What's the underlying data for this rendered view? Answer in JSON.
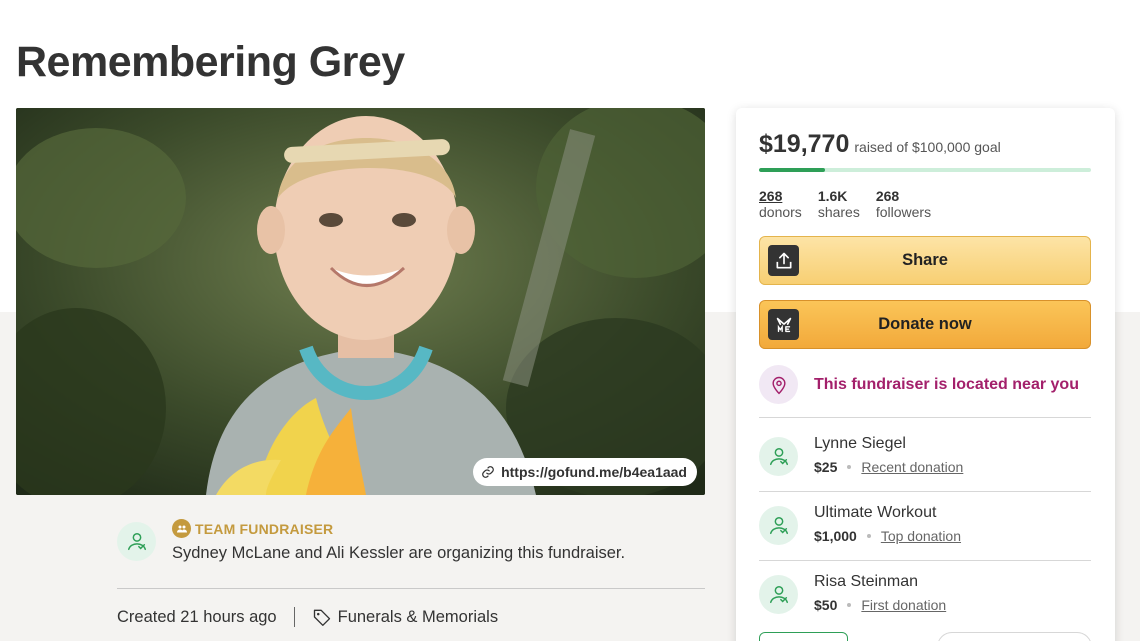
{
  "page": {
    "title": "Remembering Grey"
  },
  "hero": {
    "short_url": "https://gofund.me/b4ea1aad"
  },
  "organizer": {
    "team_label": "TEAM FUNDRAISER",
    "text": "Sydney McLane and Ali Kessler are organizing this fundraiser."
  },
  "meta": {
    "created": "Created 21 hours ago",
    "category": "Funerals & Memorials"
  },
  "progress": {
    "raised": "$19,770",
    "goal_text": "raised of $100,000 goal",
    "fraction": 0.1977,
    "donors_count": "268",
    "donors_label": "donors",
    "shares_count": "1.6K",
    "shares_label": "shares",
    "followers_count": "268",
    "followers_label": "followers"
  },
  "actions": {
    "share_label": "Share",
    "donate_label": "Donate now"
  },
  "location_notice": "This fundraiser is located near you",
  "donations": [
    {
      "name": "Lynne Siegel",
      "amount": "$25",
      "type": "Recent donation"
    },
    {
      "name": "Ultimate Workout",
      "amount": "$1,000",
      "type": "Top donation"
    },
    {
      "name": "Risa Steinman",
      "amount": "$50",
      "type": "First donation"
    }
  ],
  "colors": {
    "brand_green": "#2e9f57",
    "donate_orange": "#f2a93b",
    "share_yellow": "#f7cf73",
    "location_magenta": "#a3206b",
    "team_gold": "#c49a3e"
  },
  "icons": {
    "share": "share-upload-icon",
    "donate": "gofundme-logo-icon",
    "location": "location-pin-icon",
    "link": "link-icon",
    "category": "tag-icon",
    "team": "team-icon",
    "avatar": "donor-heart-hand-icon"
  }
}
